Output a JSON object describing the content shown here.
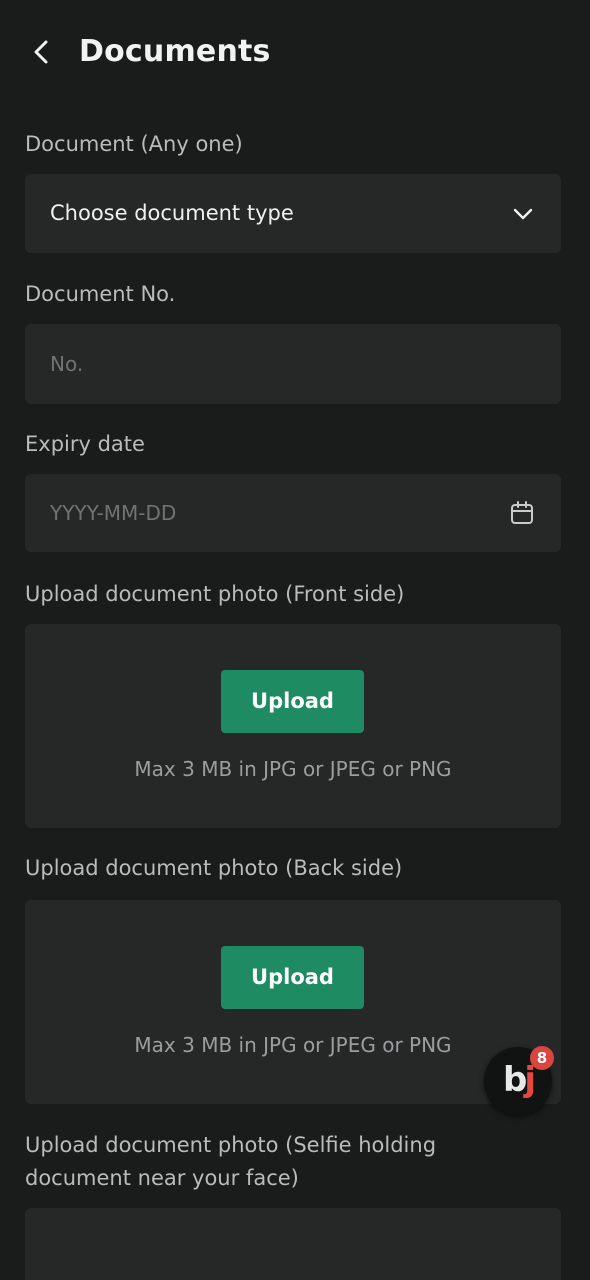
{
  "header": {
    "title": "Documents",
    "back_icon": "chevron-left-icon"
  },
  "document_type": {
    "label": "Document (Any one)",
    "value": "Choose document type",
    "icon": "chevron-down-icon"
  },
  "document_no": {
    "label": "Document No.",
    "value": "",
    "placeholder": "No."
  },
  "expiry_date": {
    "label": "Expiry date",
    "value": "",
    "placeholder": "YYYY-MM-DD",
    "icon": "calendar-icon"
  },
  "uploads": [
    {
      "label": "Upload document photo (Front side)",
      "button_label": "Upload",
      "hint": "Max 3 MB in JPG or JPEG or PNG"
    },
    {
      "label": "Upload document photo (Back side)",
      "button_label": "Upload",
      "hint": "Max 3 MB in JPG or JPEG or PNG"
    },
    {
      "label_line1": "Upload document photo (Selfie holding",
      "label_line2": "document near your face)"
    }
  ],
  "floating_badge": {
    "logo_b": "b",
    "logo_j": "j",
    "count": "8"
  },
  "colors": {
    "background": "#1a1b1b",
    "field_background": "#262828",
    "accent": "#1e8b63",
    "badge_red": "#d9463d"
  }
}
